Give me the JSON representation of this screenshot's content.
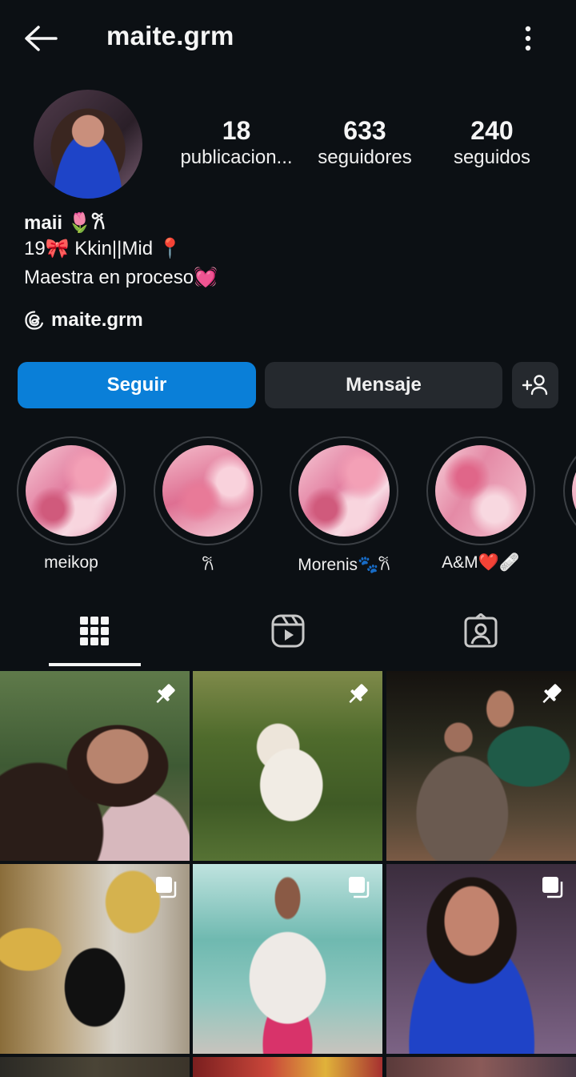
{
  "header": {
    "username": "maite.grm"
  },
  "profile": {
    "stats": [
      {
        "value": "18",
        "label": "publicacion..."
      },
      {
        "value": "633",
        "label": "seguidores"
      },
      {
        "value": "240",
        "label": "seguidos"
      }
    ],
    "name": "maii 🌷𐙚",
    "bio_line1": "19🎀 Kkin||Mid 📍",
    "bio_line2": "Maestra en proceso💓",
    "threads_handle": "maite.grm"
  },
  "actions": {
    "follow_label": "Seguir",
    "message_label": "Mensaje"
  },
  "highlights": [
    {
      "label": "meikop"
    },
    {
      "label": "𐙚"
    },
    {
      "label": "Morenis🐾𐙚"
    },
    {
      "label": "A&M❤️🩹"
    }
  ],
  "tabs": [
    "grid-icon",
    "reels-icon",
    "tagged-icon"
  ],
  "colors": {
    "background": "#0c1014",
    "follow_button": "#0a7fd8",
    "secondary_button": "#25292e"
  }
}
